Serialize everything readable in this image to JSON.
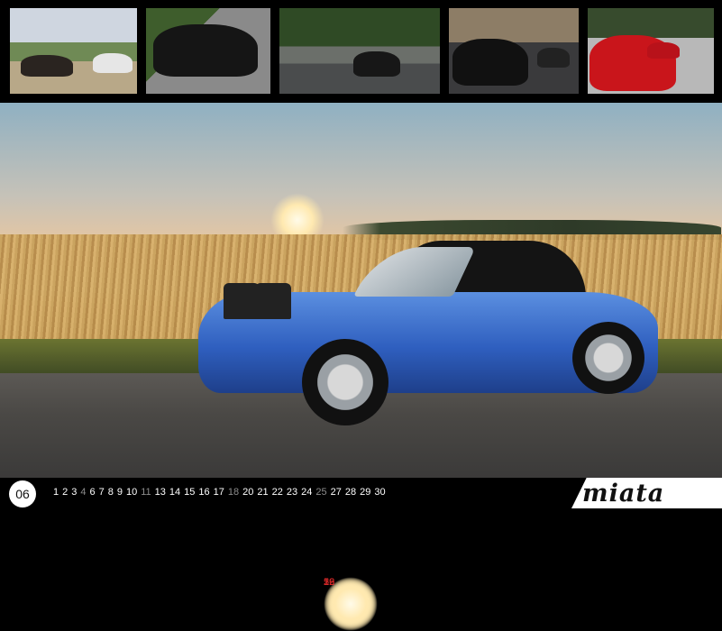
{
  "thumbnails": [
    {
      "subject": "two convertibles on gravel lot"
    },
    {
      "subject": "black convertible on road"
    },
    {
      "subject": "black convertible on mountain road"
    },
    {
      "subject": "rear view of convertibles"
    },
    {
      "subject": "red convertible"
    }
  ],
  "calendar": {
    "month_number": "06",
    "days": [
      {
        "n": "1",
        "t": "w"
      },
      {
        "n": "2",
        "t": "w"
      },
      {
        "n": "3",
        "t": "w"
      },
      {
        "n": "4",
        "t": "sat"
      },
      {
        "n": "5",
        "t": "sun"
      },
      {
        "n": "6",
        "t": "w"
      },
      {
        "n": "7",
        "t": "w"
      },
      {
        "n": "8",
        "t": "w"
      },
      {
        "n": "9",
        "t": "w"
      },
      {
        "n": "10",
        "t": "w"
      },
      {
        "n": "11",
        "t": "sat"
      },
      {
        "n": "12",
        "t": "sun"
      },
      {
        "n": "13",
        "t": "w"
      },
      {
        "n": "14",
        "t": "w"
      },
      {
        "n": "15",
        "t": "w"
      },
      {
        "n": "16",
        "t": "w"
      },
      {
        "n": "17",
        "t": "w"
      },
      {
        "n": "18",
        "t": "sat"
      },
      {
        "n": "19",
        "t": "sun"
      },
      {
        "n": "20",
        "t": "w"
      },
      {
        "n": "21",
        "t": "w"
      },
      {
        "n": "22",
        "t": "w"
      },
      {
        "n": "23",
        "t": "w"
      },
      {
        "n": "24",
        "t": "w"
      },
      {
        "n": "25",
        "t": "sat"
      },
      {
        "n": "26",
        "t": "sun"
      },
      {
        "n": "27",
        "t": "w"
      },
      {
        "n": "28",
        "t": "w"
      },
      {
        "n": "29",
        "t": "w"
      },
      {
        "n": "30",
        "t": "w"
      }
    ]
  },
  "brand": {
    "logo_text": "miata"
  },
  "colors": {
    "weekday": "#ffffff",
    "saturday": "#8c8c8c",
    "sunday": "#d62828",
    "car": "#2f5fbf"
  }
}
